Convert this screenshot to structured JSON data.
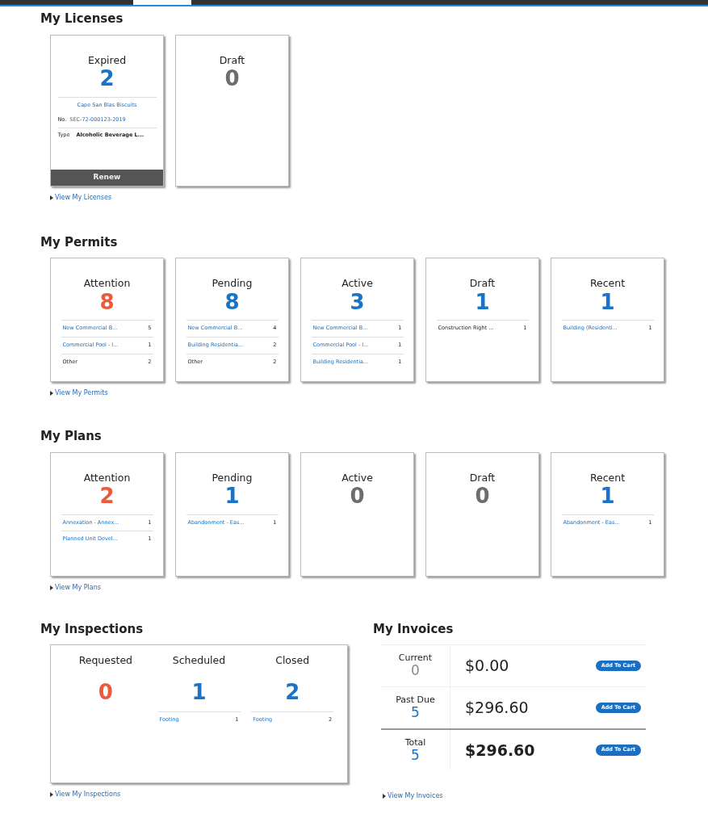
{
  "licenses": {
    "title": "My Licenses",
    "tiles": [
      {
        "label": "Expired",
        "count": "2",
        "color": "#1a73c4",
        "details": {
          "name": "Cape San Blas Biscuits",
          "number_label": "No.",
          "number": "SEC-72-000123-2019",
          "type_label": "Type",
          "type": "Alcoholic Beverage L..."
        },
        "action": "Renew"
      },
      {
        "label": "Draft",
        "count": "0",
        "color": "#6d6d6d"
      }
    ],
    "link": "View My Licenses"
  },
  "permits": {
    "title": "My Permits",
    "tiles": [
      {
        "label": "Attention",
        "count": "8",
        "color": "#ec5a3a",
        "rows": [
          {
            "name": "New Commercial B...",
            "count": "5",
            "link": true
          },
          {
            "name": "Commercial Pool - I...",
            "count": "1",
            "link": true
          },
          {
            "name": "Other",
            "count": "2",
            "link": false
          }
        ]
      },
      {
        "label": "Pending",
        "count": "8",
        "color": "#1a73c4",
        "rows": [
          {
            "name": "New Commercial B...",
            "count": "4",
            "link": true
          },
          {
            "name": "Building Residentia...",
            "count": "2",
            "link": true
          },
          {
            "name": "Other",
            "count": "2",
            "link": false
          }
        ]
      },
      {
        "label": "Active",
        "count": "3",
        "color": "#1a73c4",
        "rows": [
          {
            "name": "New Commercial B...",
            "count": "1",
            "link": true
          },
          {
            "name": "Commercial Pool - I...",
            "count": "1",
            "link": true
          },
          {
            "name": "Building Residentia...",
            "count": "1",
            "link": true
          }
        ]
      },
      {
        "label": "Draft",
        "count": "1",
        "color": "#1a73c4",
        "rows": [
          {
            "name": "Construction Right ...",
            "count": "1",
            "link": false
          }
        ]
      },
      {
        "label": "Recent",
        "count": "1",
        "color": "#1a73c4",
        "rows": [
          {
            "name": "Building (Residenti...",
            "count": "1",
            "link": true
          }
        ]
      }
    ],
    "link": "View My Permits"
  },
  "plans": {
    "title": "My Plans",
    "tiles": [
      {
        "label": "Attention",
        "count": "2",
        "color": "#ec5a3a",
        "rows": [
          {
            "name": "Annexation - Annex...",
            "count": "1",
            "link": true
          },
          {
            "name": "Planned Unit Devel...",
            "count": "1",
            "link": true
          }
        ]
      },
      {
        "label": "Pending",
        "count": "1",
        "color": "#1a73c4",
        "rows": [
          {
            "name": "Abandonment - Eas...",
            "count": "1",
            "link": true
          }
        ]
      },
      {
        "label": "Active",
        "count": "0",
        "color": "#6d6d6d"
      },
      {
        "label": "Draft",
        "count": "0",
        "color": "#6d6d6d"
      },
      {
        "label": "Recent",
        "count": "1",
        "color": "#1a73c4",
        "rows": [
          {
            "name": "Abandonment - Eas...",
            "count": "1",
            "link": true
          }
        ]
      }
    ],
    "link": "View My Plans"
  },
  "inspections": {
    "title": "My Inspections",
    "columns": [
      {
        "label": "Requested",
        "count": "0",
        "color": "#ec5a3a"
      },
      {
        "label": "Scheduled",
        "count": "1",
        "color": "#1a73c4",
        "rows": [
          {
            "name": "Footing",
            "count": "1",
            "link": true
          }
        ]
      },
      {
        "label": "Closed",
        "count": "2",
        "color": "#1a73c4",
        "rows": [
          {
            "name": "Footing",
            "count": "2",
            "link": true
          }
        ]
      }
    ],
    "link": "View My Inspections"
  },
  "invoices": {
    "title": "My Invoices",
    "rows": [
      {
        "label": "Current",
        "count": "0",
        "color": "#8a8a8a",
        "amount": "$0.00",
        "button": "Add To Cart",
        "total": false
      },
      {
        "label": "Past Due",
        "count": "5",
        "color": "#1a73c4",
        "amount": "$296.60",
        "button": "Add To Cart",
        "total": false
      },
      {
        "label": "Total",
        "count": "5",
        "color": "#1a73c4",
        "amount": "$296.60",
        "button": "Add To Cart",
        "total": true
      }
    ],
    "link": "View My Invoices"
  }
}
